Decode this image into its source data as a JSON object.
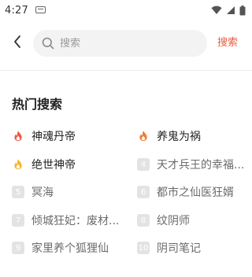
{
  "status_bar": {
    "time": "4:27"
  },
  "header": {
    "search_placeholder": "搜索",
    "search_button": "搜索"
  },
  "hot_section": {
    "title": "热门搜索",
    "items": [
      {
        "rank": "1",
        "label": "神魂丹帝",
        "badge": "fire-red"
      },
      {
        "rank": "2",
        "label": "养鬼为祸",
        "badge": "fire-orange"
      },
      {
        "rank": "3",
        "label": "绝世神帝",
        "badge": "fire-yellow"
      },
      {
        "rank": "4",
        "label": "天才兵王的幸福...",
        "badge": "gray"
      },
      {
        "rank": "5",
        "label": "冥海",
        "badge": "gray"
      },
      {
        "rank": "6",
        "label": "都市之仙医狂婿",
        "badge": "gray"
      },
      {
        "rank": "7",
        "label": "倾城狂妃：废材...",
        "badge": "gray"
      },
      {
        "rank": "8",
        "label": "纹阴师",
        "badge": "gray"
      },
      {
        "rank": "9",
        "label": "家里养个狐狸仙",
        "badge": "gray"
      },
      {
        "rank": "10",
        "label": "阴司笔记",
        "badge": "gray"
      }
    ]
  },
  "colors": {
    "accent": "#f05a3c",
    "fire_red": "#ef5a42",
    "fire_orange": "#f27a2e",
    "fire_yellow": "#f6b52a",
    "badge_gray": "#e3e3e3"
  }
}
